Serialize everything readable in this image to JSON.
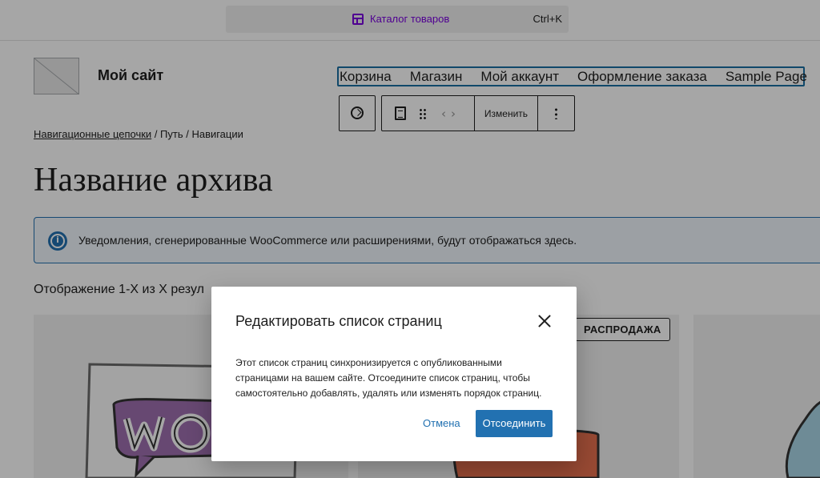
{
  "command_bar": {
    "title": "Каталог товаров",
    "shortcut": "Ctrl+K",
    "icon": "layout-icon",
    "accent_color": "#7a00df"
  },
  "site": {
    "title": "Мой сайт"
  },
  "navigation": {
    "items": [
      {
        "label": "Корзина"
      },
      {
        "label": "Магазин"
      },
      {
        "label": "Мой аккаунт"
      },
      {
        "label": "Оформление заказа"
      },
      {
        "label": "Sample Page"
      }
    ],
    "selected_outline_color": "#1a6fa3"
  },
  "block_toolbar": {
    "edit_label": "Изменить"
  },
  "breadcrumbs": {
    "link": "Навигационные цепочки",
    "rest": " / Путь / Навигации"
  },
  "archive": {
    "title": "Название архива"
  },
  "notice": {
    "text": "Уведомления, сгенерированные WooCommerce или расширениями, будут отображаться здесь.",
    "color": "#2271b1"
  },
  "products": {
    "result_count": "Отображение 1-X из X резул",
    "sale_badge": "РАСПРОДАЖА"
  },
  "modal": {
    "title": "Редактировать список страниц",
    "body": "Этот список страниц синхронизируется с опубликованными страницами на вашем сайте. Отсоедините список страниц, чтобы самостоятельно добавлять, удалять или изменять порядок страниц.",
    "cancel_label": "Отмена",
    "confirm_label": "Отсоединить",
    "primary_color": "#2271b1"
  }
}
